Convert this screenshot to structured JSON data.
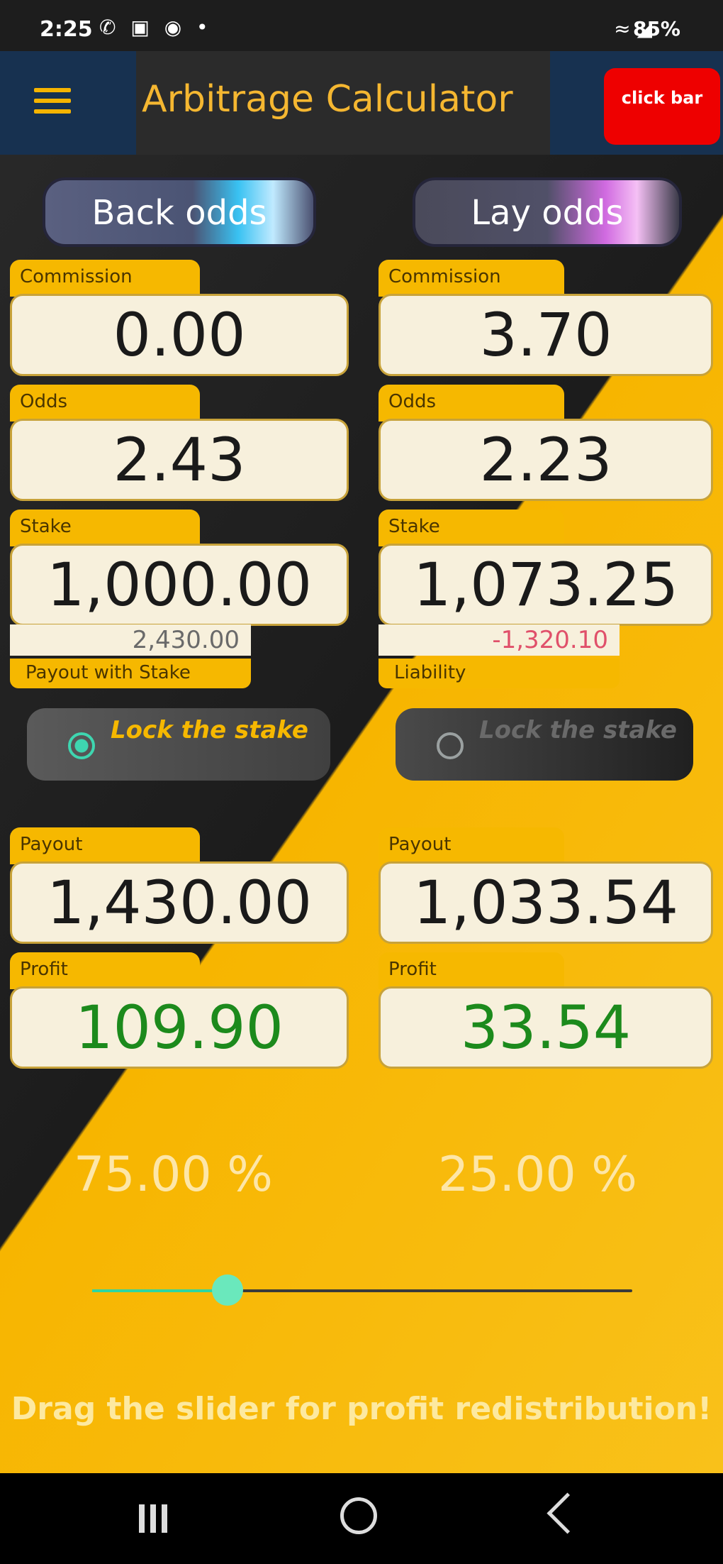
{
  "status_bar": {
    "time": "2:25",
    "left_icons": "✆ ▣ ◉ •",
    "right_icons": "≈ ◢",
    "battery": "85%"
  },
  "app_bar": {
    "title": "Arbitrage Calculator",
    "ad_label": "click bar",
    "menu_icon": "hamburger-menu-icon"
  },
  "back": {
    "button_label": "Back odds",
    "commission_label": "Commission",
    "commission": "0.00",
    "odds_label": "Odds",
    "odds": "2.43",
    "stake_label": "Stake",
    "stake": "1,000.00",
    "payout_with_stake": "2,430.00",
    "payout_with_stake_label": "Payout with Stake",
    "lock_label": "Lock the stake",
    "lock_selected": true,
    "payout_label": "Payout",
    "payout": "1,430.00",
    "profit_label": "Profit",
    "profit": "109.90",
    "percent": "75.00 %"
  },
  "lay": {
    "button_label": "Lay odds",
    "commission_label": "Commission",
    "commission": "3.70",
    "odds_label": "Odds",
    "odds": "2.23",
    "stake_label": "Stake",
    "stake": "1,073.25",
    "liability": "-1,320.10",
    "liability_label": "Liability",
    "lock_label": "Lock the stake",
    "lock_selected": false,
    "payout_label": "Payout",
    "payout": "1,033.54",
    "profit_label": "Profit",
    "profit": "33.54",
    "percent": "25.00 %"
  },
  "slider": {
    "value_fraction": 0.25
  },
  "hint": "Drag the slider for profit redistribution!",
  "colors": {
    "accent_yellow": "#f6b800",
    "profit_green": "#1c8a1c",
    "liability_red": "#e0506a",
    "slider_teal": "#2fd6a0",
    "ad_red": "#ee0000"
  },
  "nav_bar": {
    "recents_icon": "recents-icon",
    "home_icon": "home-icon",
    "back_icon": "back-icon"
  }
}
